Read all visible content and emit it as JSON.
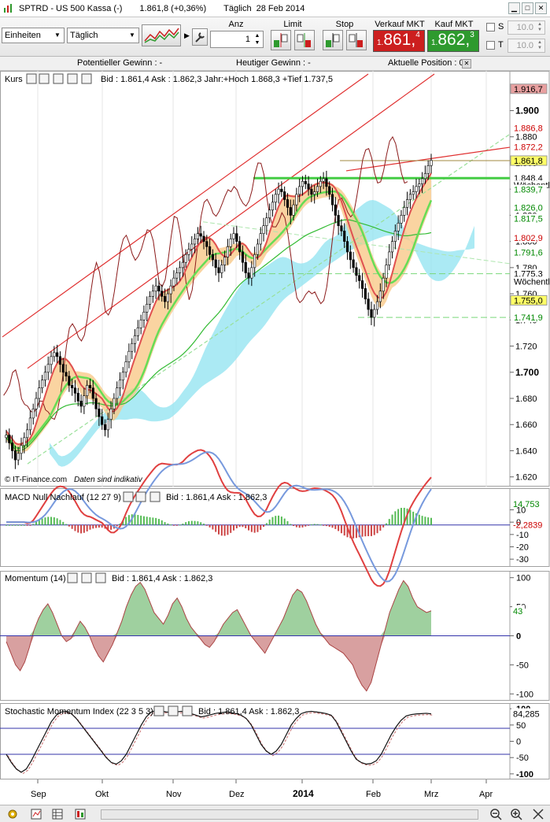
{
  "window": {
    "title": "SPTRD - US 500 Kassa (-)",
    "last_price": "1.861,8 (+0,36%)",
    "period": "Täglich",
    "date": "28 Feb 2014"
  },
  "toolbar": {
    "units_select": "Einheiten",
    "interval_select": "Täglich",
    "qty_label": "Anz",
    "qty_value": "1",
    "limit_label": "Limit",
    "stop_label": "Stop",
    "sell_label": "Verkauf MKT",
    "buy_label": "Kauf MKT",
    "sell_price": {
      "prefix": "1.",
      "main": "861,",
      "suffix": "4"
    },
    "buy_price": {
      "prefix": "1.",
      "main": "862,",
      "suffix": "3"
    },
    "s_label": "S",
    "t_label": "T",
    "s_value": "10.0",
    "t_value": "10.0",
    "colors": {
      "sell": "#cc1f1f",
      "buy": "#2e9a2e"
    }
  },
  "infobar": {
    "potential": "Potentieller Gewinn : -",
    "today": "Heutiger Gewinn : -",
    "position": "Aktuelle Position : 0"
  },
  "chart_data": [
    {
      "type": "line",
      "pane": "price",
      "title": "Kurs",
      "info": "Bid : 1.861,4 Ask : 1.862,3 Jahr:+Hoch 1.868,3 +Tief 1.737,5",
      "watermark_source": "© IT-Finance.com",
      "watermark_note": "Daten sind indikativ",
      "ylim": [
        1615,
        1928
      ],
      "y_ticks": [
        1620,
        1640,
        1660,
        1680,
        1700,
        1720,
        1740,
        1760,
        1780,
        1800,
        1820,
        1840,
        1860,
        1880,
        1900
      ],
      "y_tick_labels": [
        "1.620",
        "1.640",
        "1.660",
        "1.680",
        "1.700",
        "1.720",
        "1.740",
        "1.760",
        "1.780",
        "1.800",
        "1.820",
        "1.840",
        "1.860",
        "1.880",
        "1.900"
      ],
      "major_ticks": [
        1700,
        1900
      ],
      "x_labels": [
        "Sep",
        "Okt",
        "Nov",
        "Dez",
        "2014",
        "Feb",
        "Mrz",
        "Apr"
      ],
      "price_tags": [
        {
          "label": "1.916,7",
          "value": 1916.7,
          "color": "#e8a0a0",
          "text": "#000000"
        },
        {
          "label": "1.886,8",
          "value": 1886.8,
          "color": "#ffffff",
          "text": "#cc0000"
        },
        {
          "label": "1.872,2",
          "value": 1872.2,
          "color": "#ffffff",
          "text": "#cc0000"
        },
        {
          "label": "1.861,8",
          "value": 1861.8,
          "color": "#ffff66",
          "text": "#000000"
        },
        {
          "label": "1.848,4",
          "value": 1848.4,
          "color": "#ffffff",
          "text": "#000000"
        },
        {
          "label": "Wöchentl",
          "value": 1843.0,
          "color": "#ffffff",
          "text": "#000000"
        },
        {
          "label": "1.839,7",
          "value": 1839.7,
          "color": "#ffffff",
          "text": "#008800"
        },
        {
          "label": "1.826,0",
          "value": 1826.0,
          "color": "#ffffff",
          "text": "#008800"
        },
        {
          "label": "1.817,5",
          "value": 1817.5,
          "color": "#ffffff",
          "text": "#008800"
        },
        {
          "label": "1.802,9",
          "value": 1802.9,
          "color": "#ffffff",
          "text": "#cc0000"
        },
        {
          "label": "1.791,6",
          "value": 1791.6,
          "color": "#ffffff",
          "text": "#008800"
        },
        {
          "label": "1.775,3",
          "value": 1775.3,
          "color": "#ffffff",
          "text": "#000000"
        },
        {
          "label": "Wöchentl",
          "value": 1769.5,
          "color": "#ffffff",
          "text": "#000000"
        },
        {
          "label": "1.755,0",
          "value": 1755.0,
          "color": "#ffff66",
          "text": "#000000"
        },
        {
          "label": "1.741,9",
          "value": 1741.9,
          "color": "#ffffff",
          "text": "#008800"
        }
      ],
      "close_approx": [
        1652,
        1646,
        1640,
        1633,
        1638,
        1644,
        1650,
        1656,
        1665,
        1672,
        1680,
        1688,
        1694,
        1700,
        1706,
        1712,
        1715,
        1712,
        1706,
        1700,
        1697,
        1690,
        1688,
        1684,
        1678,
        1674,
        1682,
        1690,
        1688,
        1680,
        1672,
        1666,
        1660,
        1656,
        1664,
        1672,
        1680,
        1688,
        1694,
        1700,
        1708,
        1716,
        1722,
        1728,
        1734,
        1740,
        1746,
        1752,
        1758,
        1762,
        1766,
        1762,
        1758,
        1754,
        1760,
        1766,
        1772,
        1776,
        1780,
        1784,
        1790,
        1794,
        1798,
        1802,
        1806,
        1804,
        1800,
        1796,
        1790,
        1786,
        1780,
        1776,
        1782,
        1788,
        1796,
        1802,
        1806,
        1800,
        1792,
        1784,
        1776,
        1772,
        1780,
        1790,
        1798,
        1806,
        1812,
        1818,
        1824,
        1830,
        1836,
        1840,
        1838,
        1832,
        1826,
        1820,
        1828,
        1836,
        1842,
        1846,
        1844,
        1840,
        1836,
        1838,
        1842,
        1846,
        1848,
        1842,
        1836,
        1828,
        1820,
        1812,
        1808,
        1800,
        1792,
        1786,
        1780,
        1774,
        1770,
        1764,
        1756,
        1748,
        1742,
        1748,
        1754,
        1762,
        1772,
        1782,
        1792,
        1800,
        1808,
        1814,
        1820,
        1826,
        1832,
        1836,
        1838,
        1842,
        1844,
        1848,
        1852,
        1858,
        1862
      ]
    },
    {
      "type": "bar",
      "pane": "macd",
      "title": "MACD Null Nachlauf (12 27 9)",
      "info": "Bid : 1.861,4 Ask : 1.862,3",
      "ylim": [
        -35,
        25
      ],
      "y_ticks": [
        10,
        0,
        -10,
        -20,
        -30
      ],
      "y_tick_labels": [
        "10",
        "0",
        "-10",
        "-20",
        "-30"
      ],
      "values_tags": [
        {
          "label": "14,753",
          "value": 14.753,
          "text": "#008800"
        },
        {
          "label": "-2,2839",
          "value": -2.2839,
          "text": "#cc0000"
        }
      ]
    },
    {
      "type": "area",
      "pane": "momentum",
      "title": "Momentum (14)",
      "info": "Bid : 1.861,4 Ask : 1.862,3",
      "ylim": [
        -105,
        105
      ],
      "y_ticks": [
        100,
        50,
        0,
        -50,
        -100
      ],
      "y_tick_labels": [
        "100",
        "50",
        "0",
        "-50",
        "-100"
      ],
      "last_tag": {
        "label": "43",
        "value": 43
      },
      "values_approx": [
        -10,
        -30,
        -50,
        -60,
        -45,
        -20,
        10,
        30,
        45,
        55,
        40,
        20,
        0,
        -10,
        -5,
        10,
        25,
        15,
        0,
        -20,
        -35,
        -45,
        -30,
        -15,
        5,
        25,
        50,
        70,
        85,
        92,
        80,
        60,
        40,
        30,
        20,
        35,
        55,
        65,
        50,
        30,
        15,
        5,
        -5,
        -15,
        -20,
        -10,
        5,
        20,
        30,
        40,
        45,
        30,
        15,
        0,
        -10,
        -20,
        -30,
        -15,
        0,
        15,
        30,
        50,
        70,
        80,
        75,
        60,
        40,
        20,
        5,
        -5,
        -15,
        -20,
        -25,
        -30,
        -40,
        -50,
        -70,
        -85,
        -95,
        -80,
        -50,
        -20,
        10,
        40,
        60,
        80,
        95,
        85,
        65,
        50,
        45,
        40,
        43
      ]
    },
    {
      "type": "line",
      "pane": "stochastic",
      "title": "Stochastic Momentum Index (22 3 5 3)",
      "info": "Bid : 1.861,4 Ask : 1.862,3",
      "ylim": [
        -110,
        110
      ],
      "y_ticks": [
        100,
        50,
        0,
        -50,
        -100
      ],
      "y_tick_labels": [
        "100",
        "50",
        "0",
        "-50",
        "-100"
      ],
      "last_tag": {
        "label": "84,285",
        "value": 84.285
      },
      "values_approx": [
        -40,
        -65,
        -85,
        -95,
        -85,
        -60,
        -30,
        0,
        30,
        60,
        80,
        90,
        92,
        85,
        70,
        50,
        30,
        10,
        -10,
        -30,
        -50,
        -65,
        -70,
        -60,
        -40,
        -10,
        20,
        50,
        75,
        90,
        95,
        93,
        90,
        88,
        90,
        92,
        90,
        85,
        80,
        75,
        78,
        82,
        86,
        88,
        90,
        88,
        85,
        80,
        70,
        50,
        20,
        -10,
        -30,
        -40,
        -30,
        -10,
        20,
        50,
        70,
        85,
        90,
        92,
        90,
        88,
        85,
        80,
        60,
        30,
        0,
        -30,
        -55,
        -65,
        -70,
        -68,
        -60,
        -40,
        -10,
        20,
        45,
        65,
        78,
        82,
        84,
        85,
        86,
        84.285
      ]
    }
  ],
  "bottom": {
    "icons": [
      "settings-icon",
      "indicator-icon",
      "table-icon",
      "drawing-icon",
      "zoom-out-icon",
      "zoom-in-icon",
      "fit-icon"
    ]
  }
}
